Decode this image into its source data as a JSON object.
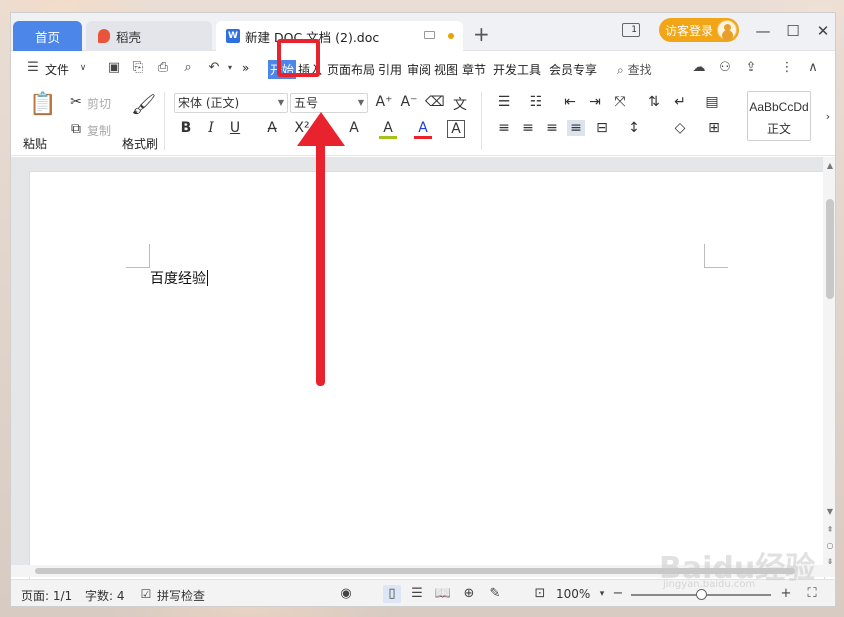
{
  "titlebar": {
    "home_tab": "首页",
    "daoke_tab": "稻壳",
    "doc_tab": "新建 DOC 文档 (2).doc",
    "new_tab": "+",
    "layout_label": "1",
    "login": "访客登录"
  },
  "menubar": {
    "file": "文件",
    "more": "»",
    "tabs": [
      "开始",
      "插入",
      "页面布局",
      "引用",
      "审阅",
      "视图",
      "章节",
      "开发工具",
      "会员专享"
    ],
    "search": "查找"
  },
  "ribbon": {
    "paste": "粘贴",
    "cut": "剪切",
    "copy": "复制",
    "format_painter": "格式刷",
    "font_name": "宋体 (正文)",
    "font_size": "五号",
    "style_sample": "AaBbCcDd",
    "style_name": "正文",
    "bold": "B",
    "italic": "I",
    "underline": "U",
    "font_color": "A",
    "highlight": "A"
  },
  "document": {
    "text": "百度经验"
  },
  "statusbar": {
    "page": "页面: 1/1",
    "words": "字数: 4",
    "spellcheck": "拼写检查",
    "zoom": "100%"
  },
  "watermark": {
    "brand": "Baidu经验",
    "url": "jingyan.baidu.com"
  },
  "colors": {
    "accent": "#4b86e8",
    "annotation": "#e8232e",
    "login": "#f2a516"
  }
}
